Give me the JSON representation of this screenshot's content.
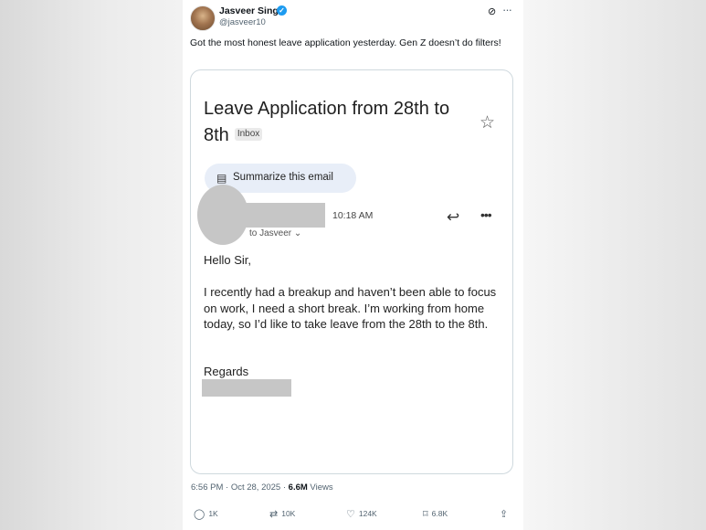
{
  "author": {
    "name": "Jasveer Singh",
    "handle": "@jasveer10"
  },
  "tweet": {
    "text": "Got the most honest leave application yesterday. Gen Z doesn’t do filters!",
    "timestamp": "6:56 PM · Oct 28, 2025 · ",
    "views_count": "6.6M",
    "views_label": " Views"
  },
  "email": {
    "subject": "Leave Application from 28th to 8th",
    "inbox_label": "Inbox",
    "summarize_label": "Summarize this email",
    "time": "10:18 AM",
    "to_line": "to Jasveer ⌄",
    "greeting": "Hello Sir,",
    "body": "I recently had a breakup and haven’t been able to focus on work, I need a short break. I’m working from home today, so I’d like to take leave from the 28th to the 8th.",
    "closing": "Regards"
  },
  "actions": {
    "replies": "1K",
    "reposts": "10K",
    "likes": "124K",
    "bookmarks": "6.8K"
  },
  "icons": {
    "verified": "verified-badge-icon",
    "grok": "grok-icon",
    "star": "star-icon",
    "reply_email": "reply-arrow-icon",
    "share": "share-icon"
  },
  "colors": {
    "verified": "#1d9bf0",
    "text": "#0f1419",
    "muted": "#536471",
    "summarize_bg": "#e8eef8"
  }
}
